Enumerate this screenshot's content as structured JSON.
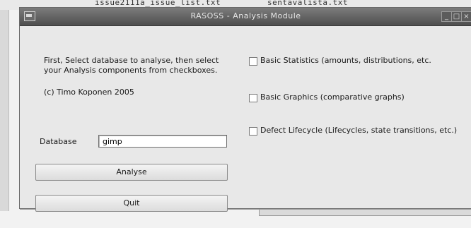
{
  "background": {
    "file_left": "issue2111a_issue_list.txt",
    "file_right": "sentavalista.txt"
  },
  "window": {
    "title": "RASOSS - Analysis Module",
    "buttons": {
      "minimize": "_",
      "maximize": "□",
      "close": "×"
    }
  },
  "intro": {
    "line1": "First, Select database to analyse, then select",
    "line2": "your Analysis components from checkboxes.",
    "copyright": "(c) Timo Koponen 2005"
  },
  "database": {
    "label": "Database",
    "value": "gimp"
  },
  "buttons": {
    "analyse": "Analyse",
    "quit": "Quit"
  },
  "checkboxes": [
    {
      "label": "Basic Statistics (amounts, distributions, etc.",
      "checked": false
    },
    {
      "label": "Basic Graphics (comparative graphs)",
      "checked": false
    },
    {
      "label": "Defect Lifecycle (Lifecycles, state transitions, etc.)",
      "checked": false
    }
  ]
}
